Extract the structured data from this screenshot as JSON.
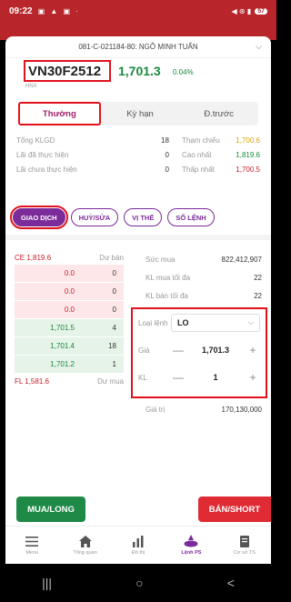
{
  "status": {
    "time": "09:22",
    "icons": "▣ ▲ ▣ ·",
    "signal": "◀ ⊛ ▮",
    "battery": "57"
  },
  "account": {
    "label": "081-C-021184-80: NGÔ MINH TUẤN"
  },
  "symbol": {
    "code": "VN30F2512",
    "price": "1,701.3",
    "change_pct": "0.04%",
    "sub": "HNX"
  },
  "tabs": [
    {
      "label": "Thường"
    },
    {
      "label": "Kỳ hạn"
    },
    {
      "label": "Đ.trước"
    }
  ],
  "info": [
    {
      "label": "Tổng KLGD",
      "value": "18",
      "label2": "Tham chiếu",
      "value2": "1,700.6"
    },
    {
      "label": "Lãi đã thực hiện",
      "value": "0",
      "label2": "Cao nhất",
      "value2": "1,819.6"
    },
    {
      "label": "Lãi chưa thực hiện",
      "value": "0",
      "label2": "Thấp nhất",
      "value2": "1,700.5"
    }
  ],
  "order_buttons": [
    {
      "label": "GIAO DỊCH"
    },
    {
      "label": "HUỶ/SỬA"
    },
    {
      "label": "VỊ THẾ"
    },
    {
      "label": "SỔ LỆNH"
    }
  ],
  "book": {
    "ceiling": "CE 1,819.6",
    "sell_header": "Dư bán",
    "floor": "FL 1,581.6",
    "buy_header": "Dư mua",
    "sells": [
      {
        "price": "0.0",
        "qty": "0"
      },
      {
        "price": "0.0",
        "qty": "0"
      },
      {
        "price": "0.0",
        "qty": "0"
      }
    ],
    "buys": [
      {
        "price": "1,701.5",
        "qty": "4"
      },
      {
        "price": "1,701.4",
        "qty": "18"
      },
      {
        "price": "1,701.2",
        "qty": "1"
      }
    ]
  },
  "right_info": [
    {
      "label": "Sức mua",
      "value": "822,412,907"
    },
    {
      "label": "KL mua tối đa",
      "value": "22"
    },
    {
      "label": "KL bán tối đa",
      "value": "22"
    }
  ],
  "form": {
    "order_type_label": "Loại lệnh",
    "order_type_value": "LO",
    "price_label": "Giá",
    "price_value": "1,701.3",
    "qty_label": "KL",
    "qty_value": "1"
  },
  "total": {
    "label": "Giá trị",
    "value": "170,130,000"
  },
  "actions": {
    "buy": "MUA/LONG",
    "sell": "BÁN/SHORT"
  },
  "nav": [
    {
      "label": "Menu"
    },
    {
      "label": "Tổng quan"
    },
    {
      "label": "Đồ thị"
    },
    {
      "label": "Lệnh PS"
    },
    {
      "label": "Cơ sở TS"
    }
  ],
  "android": {
    "recent": "|||",
    "home": "○",
    "back": "<"
  }
}
